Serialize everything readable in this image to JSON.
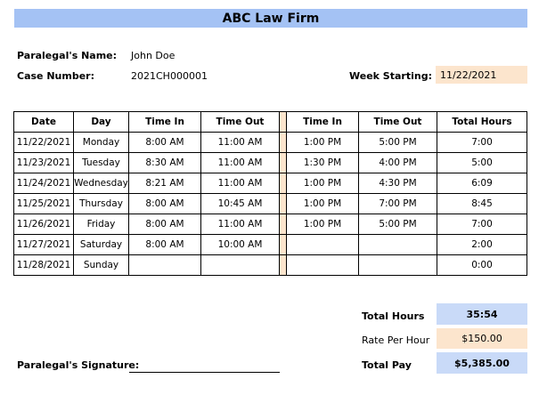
{
  "title": "ABC Law Firm",
  "header": {
    "name_label": "Paralegal's Name:",
    "name_value": "John Doe",
    "case_label": "Case Number:",
    "case_value": "2021CH000001",
    "week_label": "Week Starting:",
    "week_value": "11/22/2021"
  },
  "columns": [
    "Date",
    "Day",
    "Time In",
    "Time Out",
    "Time In",
    "Time Out",
    "Total Hours"
  ],
  "rows": [
    {
      "date": "11/22/2021",
      "day": "Monday",
      "in1": "8:00 AM",
      "out1": "11:00 AM",
      "in2": "1:00 PM",
      "out2": "5:00 PM",
      "total": "7:00"
    },
    {
      "date": "11/23/2021",
      "day": "Tuesday",
      "in1": "8:30 AM",
      "out1": "11:00 AM",
      "in2": "1:30 PM",
      "out2": "4:00 PM",
      "total": "5:00"
    },
    {
      "date": "11/24/2021",
      "day": "Wednesday",
      "in1": "8:21 AM",
      "out1": "11:00 AM",
      "in2": "1:00 PM",
      "out2": "4:30 PM",
      "total": "6:09"
    },
    {
      "date": "11/25/2021",
      "day": "Thursday",
      "in1": "8:00 AM",
      "out1": "10:45 AM",
      "in2": "1:00 PM",
      "out2": "7:00 PM",
      "total": "8:45"
    },
    {
      "date": "11/26/2021",
      "day": "Friday",
      "in1": "8:00 AM",
      "out1": "11:00 AM",
      "in2": "1:00 PM",
      "out2": "5:00 PM",
      "total": "7:00"
    },
    {
      "date": "11/27/2021",
      "day": "Saturday",
      "in1": "8:00 AM",
      "out1": "10:00 AM",
      "in2": "",
      "out2": "",
      "total": "2:00"
    },
    {
      "date": "11/28/2021",
      "day": "Sunday",
      "in1": "",
      "out1": "",
      "in2": "",
      "out2": "",
      "total": "0:00"
    }
  ],
  "summary": {
    "total_hours_label": "Total Hours",
    "total_hours_value": "35:54",
    "rate_label": "Rate Per Hour",
    "rate_value": "$150.00",
    "total_pay_label": "Total Pay",
    "total_pay_value": "$5,385.00"
  },
  "signature_label": "Paralegal's Signature:"
}
